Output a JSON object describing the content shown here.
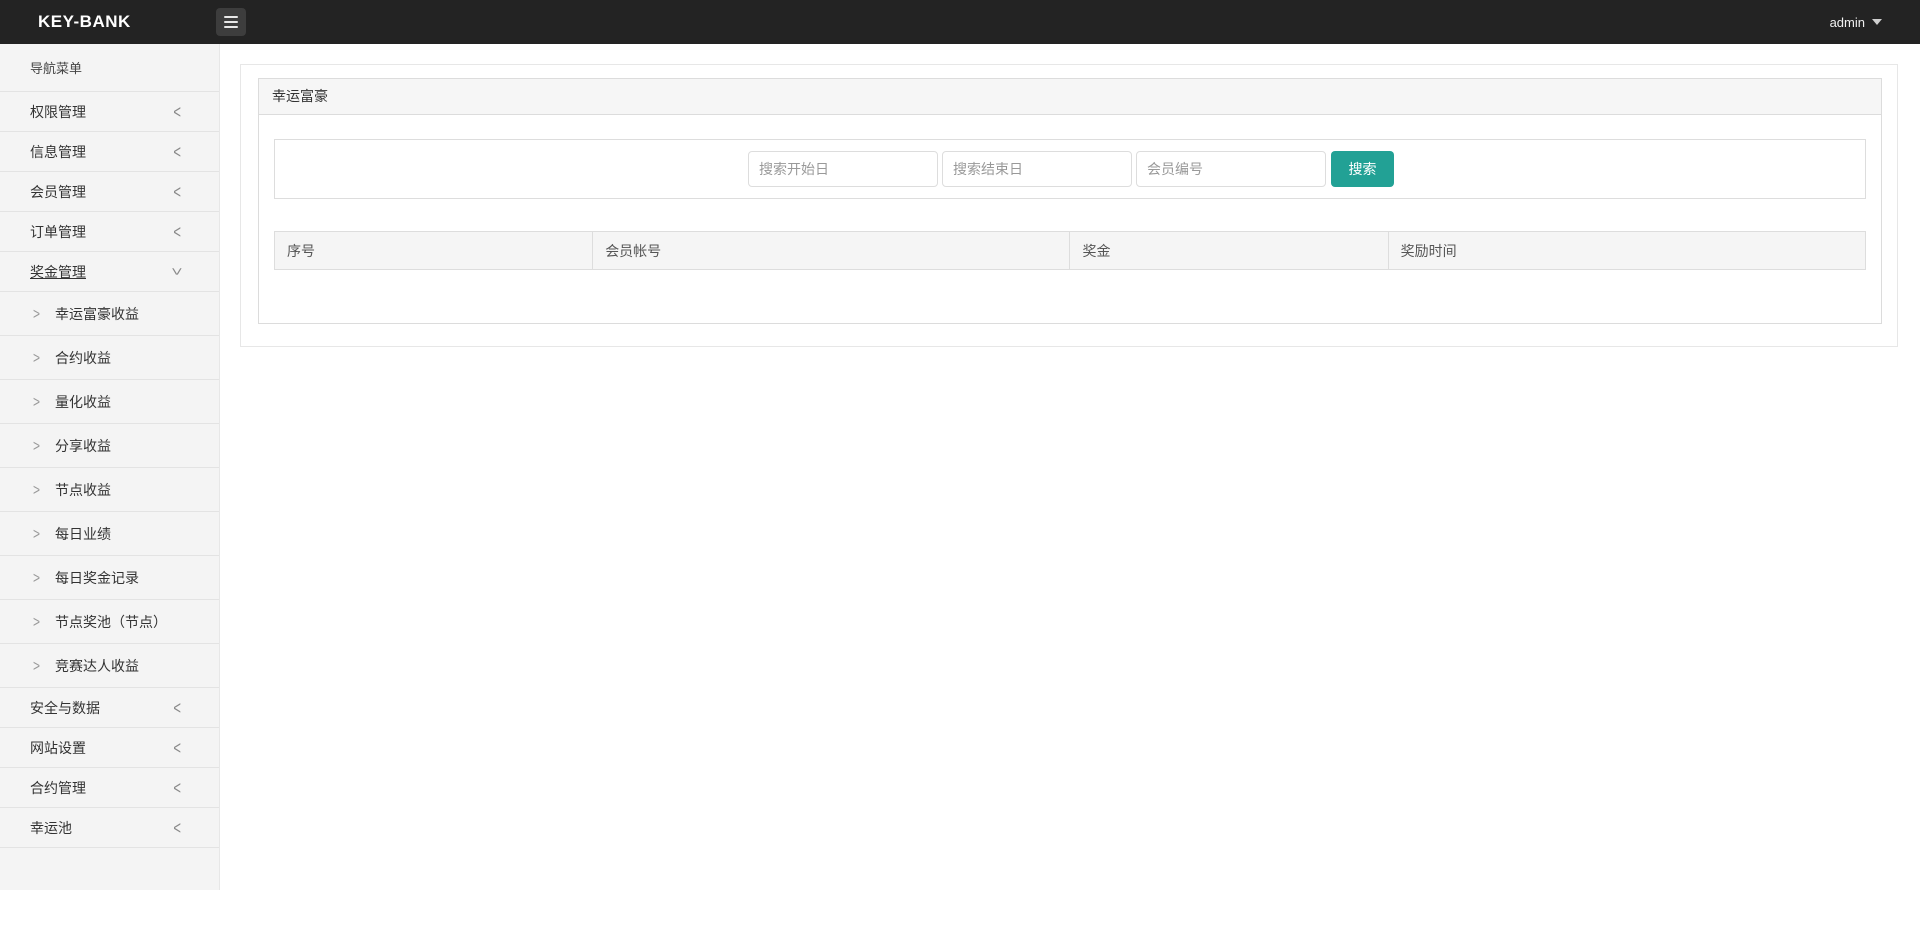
{
  "topbar": {
    "brand": "KEY-BANK",
    "user": "admin"
  },
  "sidebar": {
    "nav_header": "导航菜单",
    "items": [
      {
        "label": "权限管理",
        "state": "collapsed"
      },
      {
        "label": "信息管理",
        "state": "collapsed"
      },
      {
        "label": "会员管理",
        "state": "collapsed"
      },
      {
        "label": "订单管理",
        "state": "collapsed"
      },
      {
        "label": "奖金管理",
        "state": "expanded",
        "active": true,
        "children": [
          "幸运富豪收益",
          "合约收益",
          "量化收益",
          "分享收益",
          "节点收益",
          "每日业绩",
          "每日奖金记录",
          "节点奖池（节点）",
          "竞赛达人收益"
        ]
      },
      {
        "label": "安全与数据",
        "state": "collapsed"
      },
      {
        "label": "网站设置",
        "state": "collapsed"
      },
      {
        "label": "合约管理",
        "state": "collapsed"
      },
      {
        "label": "幸运池",
        "state": "collapsed"
      }
    ]
  },
  "main": {
    "panel_title": "幸运富豪",
    "search": {
      "start_date_placeholder": "搜索开始日",
      "end_date_placeholder": "搜索结束日",
      "member_id_placeholder": "会员编号",
      "button_label": "搜索"
    },
    "table": {
      "headers": [
        "序号",
        "会员帐号",
        "奖金",
        "奖励时间"
      ],
      "rows": []
    }
  },
  "colors": {
    "topbar_bg": "#232323",
    "sidebar_bg": "#f4f4f4",
    "accent_teal": "#22a195",
    "table_header_bg": "#f5f5f5"
  },
  "icons": {
    "hamburger": "menu-list-icon",
    "user_caret": "caret-down-icon",
    "collapsed_chevron": "<",
    "expanded_chevron": "<",
    "submenu_arrow": ">"
  }
}
